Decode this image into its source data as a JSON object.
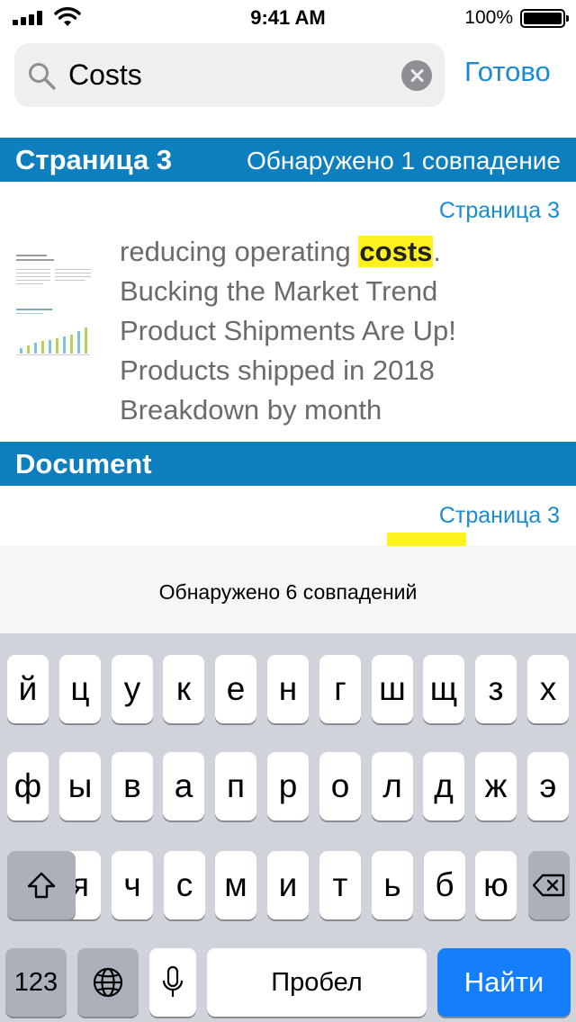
{
  "status_bar": {
    "time": "9:41 AM",
    "battery": "100%"
  },
  "search": {
    "value": "Costs",
    "done_label": "Готово"
  },
  "sections": [
    {
      "title": "Страница 3",
      "count": "Обнаружено 1 совпадение"
    },
    {
      "title": "Document"
    }
  ],
  "results": [
    {
      "page": "Страница 3",
      "pre": "reducing operating ",
      "match": "costs",
      "post": ".",
      "lines": [
        "Bucking the Market Trend",
        "Product Shipments Are Up!",
        "Products shipped in 2018",
        "Breakdown by month"
      ]
    },
    {
      "page": "Страница 3"
    }
  ],
  "match_bar": {
    "text": "Обнаружено 6 совпадений"
  },
  "keyboard": {
    "row1": [
      "й",
      "ц",
      "у",
      "к",
      "е",
      "н",
      "г",
      "ш",
      "щ",
      "з",
      "х"
    ],
    "row2": [
      "ф",
      "ы",
      "в",
      "а",
      "п",
      "р",
      "о",
      "л",
      "д",
      "ж",
      "э"
    ],
    "row3": [
      "я",
      "ч",
      "с",
      "м",
      "и",
      "т",
      "ь",
      "б",
      "ю"
    ],
    "numbers_label": "123",
    "space_label": "Пробел",
    "search_label": "Найти"
  },
  "colors": {
    "accent": "#1a8bd0",
    "section_header": "#0d7fbf",
    "highlight": "#fff21e",
    "keyboard_bg": "#d0d3d9",
    "search_key": "#157efb"
  }
}
